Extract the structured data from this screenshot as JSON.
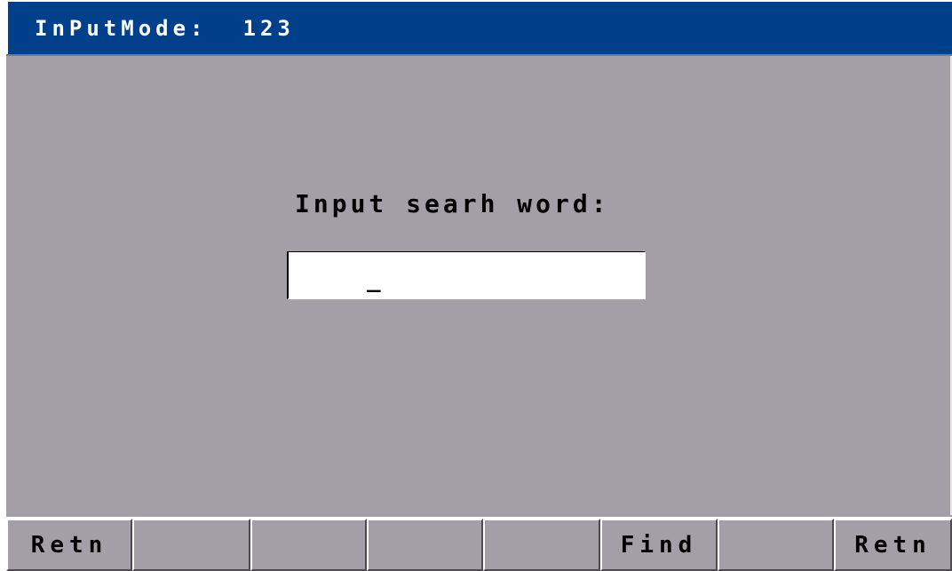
{
  "header": {
    "mode_label": "InPutMode:",
    "mode_value": "123"
  },
  "search": {
    "prompt": "Input searh word:",
    "value": "",
    "cursor": "_"
  },
  "softkeys": [
    {
      "label": "Retn"
    },
    {
      "label": ""
    },
    {
      "label": ""
    },
    {
      "label": ""
    },
    {
      "label": ""
    },
    {
      "label": "Find"
    },
    {
      "label": ""
    },
    {
      "label": "Retn"
    }
  ]
}
